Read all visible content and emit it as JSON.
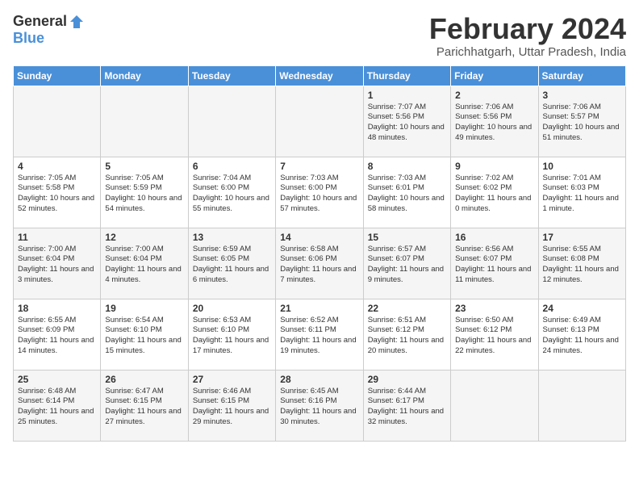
{
  "logo": {
    "general": "General",
    "blue": "Blue"
  },
  "title": "February 2024",
  "location": "Parichhatgarh, Uttar Pradesh, India",
  "headers": [
    "Sunday",
    "Monday",
    "Tuesday",
    "Wednesday",
    "Thursday",
    "Friday",
    "Saturday"
  ],
  "weeks": [
    [
      {
        "day": "",
        "info": ""
      },
      {
        "day": "",
        "info": ""
      },
      {
        "day": "",
        "info": ""
      },
      {
        "day": "",
        "info": ""
      },
      {
        "day": "1",
        "info": "Sunrise: 7:07 AM\nSunset: 5:56 PM\nDaylight: 10 hours\nand 48 minutes."
      },
      {
        "day": "2",
        "info": "Sunrise: 7:06 AM\nSunset: 5:56 PM\nDaylight: 10 hours\nand 49 minutes."
      },
      {
        "day": "3",
        "info": "Sunrise: 7:06 AM\nSunset: 5:57 PM\nDaylight: 10 hours\nand 51 minutes."
      }
    ],
    [
      {
        "day": "4",
        "info": "Sunrise: 7:05 AM\nSunset: 5:58 PM\nDaylight: 10 hours\nand 52 minutes."
      },
      {
        "day": "5",
        "info": "Sunrise: 7:05 AM\nSunset: 5:59 PM\nDaylight: 10 hours\nand 54 minutes."
      },
      {
        "day": "6",
        "info": "Sunrise: 7:04 AM\nSunset: 6:00 PM\nDaylight: 10 hours\nand 55 minutes."
      },
      {
        "day": "7",
        "info": "Sunrise: 7:03 AM\nSunset: 6:00 PM\nDaylight: 10 hours\nand 57 minutes."
      },
      {
        "day": "8",
        "info": "Sunrise: 7:03 AM\nSunset: 6:01 PM\nDaylight: 10 hours\nand 58 minutes."
      },
      {
        "day": "9",
        "info": "Sunrise: 7:02 AM\nSunset: 6:02 PM\nDaylight: 11 hours\nand 0 minutes."
      },
      {
        "day": "10",
        "info": "Sunrise: 7:01 AM\nSunset: 6:03 PM\nDaylight: 11 hours\nand 1 minute."
      }
    ],
    [
      {
        "day": "11",
        "info": "Sunrise: 7:00 AM\nSunset: 6:04 PM\nDaylight: 11 hours\nand 3 minutes."
      },
      {
        "day": "12",
        "info": "Sunrise: 7:00 AM\nSunset: 6:04 PM\nDaylight: 11 hours\nand 4 minutes."
      },
      {
        "day": "13",
        "info": "Sunrise: 6:59 AM\nSunset: 6:05 PM\nDaylight: 11 hours\nand 6 minutes."
      },
      {
        "day": "14",
        "info": "Sunrise: 6:58 AM\nSunset: 6:06 PM\nDaylight: 11 hours\nand 7 minutes."
      },
      {
        "day": "15",
        "info": "Sunrise: 6:57 AM\nSunset: 6:07 PM\nDaylight: 11 hours\nand 9 minutes."
      },
      {
        "day": "16",
        "info": "Sunrise: 6:56 AM\nSunset: 6:07 PM\nDaylight: 11 hours\nand 11 minutes."
      },
      {
        "day": "17",
        "info": "Sunrise: 6:55 AM\nSunset: 6:08 PM\nDaylight: 11 hours\nand 12 minutes."
      }
    ],
    [
      {
        "day": "18",
        "info": "Sunrise: 6:55 AM\nSunset: 6:09 PM\nDaylight: 11 hours\nand 14 minutes."
      },
      {
        "day": "19",
        "info": "Sunrise: 6:54 AM\nSunset: 6:10 PM\nDaylight: 11 hours\nand 15 minutes."
      },
      {
        "day": "20",
        "info": "Sunrise: 6:53 AM\nSunset: 6:10 PM\nDaylight: 11 hours\nand 17 minutes."
      },
      {
        "day": "21",
        "info": "Sunrise: 6:52 AM\nSunset: 6:11 PM\nDaylight: 11 hours\nand 19 minutes."
      },
      {
        "day": "22",
        "info": "Sunrise: 6:51 AM\nSunset: 6:12 PM\nDaylight: 11 hours\nand 20 minutes."
      },
      {
        "day": "23",
        "info": "Sunrise: 6:50 AM\nSunset: 6:12 PM\nDaylight: 11 hours\nand 22 minutes."
      },
      {
        "day": "24",
        "info": "Sunrise: 6:49 AM\nSunset: 6:13 PM\nDaylight: 11 hours\nand 24 minutes."
      }
    ],
    [
      {
        "day": "25",
        "info": "Sunrise: 6:48 AM\nSunset: 6:14 PM\nDaylight: 11 hours\nand 25 minutes."
      },
      {
        "day": "26",
        "info": "Sunrise: 6:47 AM\nSunset: 6:15 PM\nDaylight: 11 hours\nand 27 minutes."
      },
      {
        "day": "27",
        "info": "Sunrise: 6:46 AM\nSunset: 6:15 PM\nDaylight: 11 hours\nand 29 minutes."
      },
      {
        "day": "28",
        "info": "Sunrise: 6:45 AM\nSunset: 6:16 PM\nDaylight: 11 hours\nand 30 minutes."
      },
      {
        "day": "29",
        "info": "Sunrise: 6:44 AM\nSunset: 6:17 PM\nDaylight: 11 hours\nand 32 minutes."
      },
      {
        "day": "",
        "info": ""
      },
      {
        "day": "",
        "info": ""
      }
    ]
  ]
}
